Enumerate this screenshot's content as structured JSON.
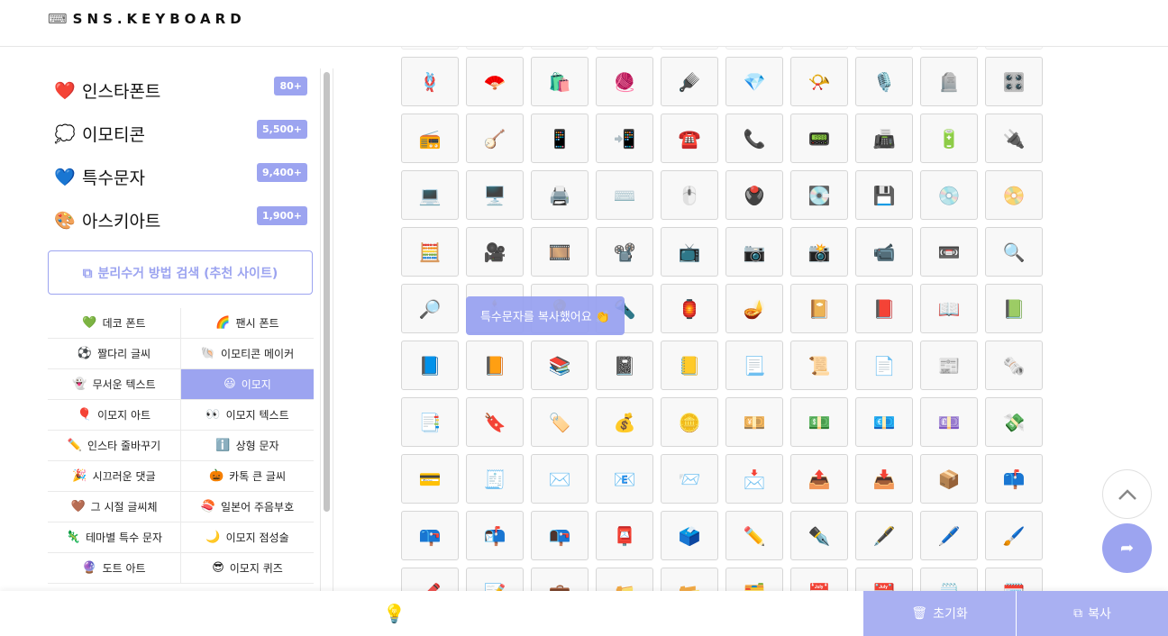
{
  "brand": {
    "logo_icon": "⌨",
    "name": "SNS.KEYBOARD"
  },
  "categories": [
    {
      "emoji": "❤️",
      "label": "인스타폰트",
      "count": "80+"
    },
    {
      "emoji": "💭",
      "label": "이모티콘",
      "count": "5,500+"
    },
    {
      "emoji": "💙",
      "label": "특수문자",
      "count": "9,400+"
    },
    {
      "emoji": "🎨",
      "label": "아스키아트",
      "count": "1,900+"
    }
  ],
  "search_button": {
    "icon": "external-link-icon",
    "label": "분리수거 방법 검색 (추천 사이트)"
  },
  "sublinks": [
    {
      "emoji": "💚",
      "label": "데코 폰트"
    },
    {
      "emoji": "🌈",
      "label": "팬시 폰트"
    },
    {
      "emoji": "⚽",
      "label": "짤다리 글씨"
    },
    {
      "emoji": "🐚",
      "label": "이모티콘 메이커"
    },
    {
      "emoji": "👻",
      "label": "무서운 텍스트"
    },
    {
      "emoji": "😃",
      "label": "이모지",
      "active": true
    },
    {
      "emoji": "🎈",
      "label": "이모지 아트"
    },
    {
      "emoji": "👀",
      "label": "이모지 텍스트"
    },
    {
      "emoji": "✏️",
      "label": "인스타 줄바꾸기"
    },
    {
      "emoji": "ℹ️",
      "label": "상형 문자"
    },
    {
      "emoji": "🎉",
      "label": "시끄러운 댓글"
    },
    {
      "emoji": "🎃",
      "label": "카톡 큰 글씨"
    },
    {
      "emoji": "🤎",
      "label": "그 시절 글씨체"
    },
    {
      "emoji": "🍣",
      "label": "일본어 주음부호"
    },
    {
      "emoji": "🦎",
      "label": "테마별 특수 문자"
    },
    {
      "emoji": "🌙",
      "label": "이모지 점성술"
    },
    {
      "emoji": "🔮",
      "label": "도트 아트"
    },
    {
      "emoji": "😎",
      "label": "이모지 퀴즈"
    }
  ],
  "emoji_rows": [
    [
      "🧿",
      "🪬",
      "🕹️",
      "🧸",
      "🪅",
      "🪆",
      "🖼️",
      "🧵",
      "🪡",
      "🧶"
    ],
    [
      "🪢",
      "🪭",
      "🛍️",
      "🧶",
      "🪮",
      "💎",
      "📯",
      "🎙️",
      "🪦",
      "🎛️"
    ],
    [
      "📻",
      "🪕",
      "📱",
      "📲",
      "☎️",
      "📞",
      "📟",
      "📠",
      "🔋",
      "🔌"
    ],
    [
      "💻",
      "🖥️",
      "🖨️",
      "⌨️",
      "🖱️",
      "🖲️",
      "💽",
      "💾",
      "💿",
      "📀"
    ],
    [
      "🧮",
      "🎥",
      "🎞️",
      "📽️",
      "📺",
      "📷",
      "📸",
      "📹",
      "📼",
      "🔍"
    ],
    [
      "🔎",
      "🕯️",
      "💡",
      "🔦",
      "🏮",
      "🪔",
      "📔",
      "📕",
      "📖",
      "📗"
    ],
    [
      "📘",
      "📙",
      "📚",
      "📓",
      "📒",
      "📃",
      "📜",
      "📄",
      "📰",
      "🗞️"
    ],
    [
      "📑",
      "🔖",
      "🏷️",
      "💰",
      "🪙",
      "💴",
      "💵",
      "💶",
      "💷",
      "💸"
    ],
    [
      "💳",
      "🧾",
      "✉️",
      "📧",
      "📨",
      "📩",
      "📤",
      "📥",
      "📦",
      "📫"
    ],
    [
      "📪",
      "📬",
      "📭",
      "📮",
      "🗳️",
      "✏️",
      "✒️",
      "🖋️",
      "🖊️",
      "🖌️"
    ],
    [
      "🖍️",
      "📝",
      "💼",
      "📁",
      "📂",
      "🗂️",
      "📅",
      "📆",
      "🗒️",
      "🗓️"
    ]
  ],
  "toast": "특수문자를 복사했어요 👏",
  "bottom": {
    "bulb": "💡",
    "reset_label": "초기화",
    "copy_label": "복사"
  },
  "colors": {
    "accent": "#9ca4f0",
    "button": "#a9b0f2"
  }
}
